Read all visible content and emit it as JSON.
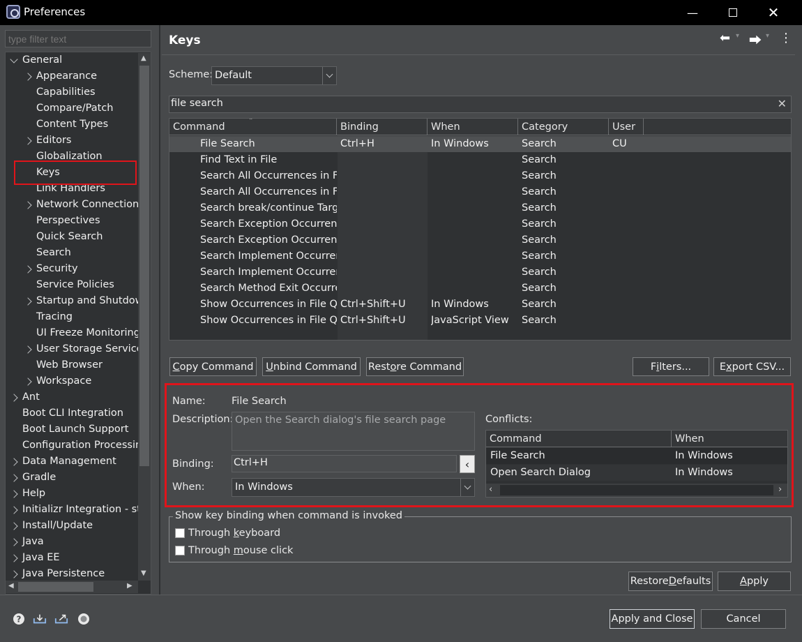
{
  "window": {
    "title": "Preferences"
  },
  "filter": {
    "placeholder": "type filter text"
  },
  "tree": [
    {
      "label": "General",
      "expander": "down",
      "indent": 0
    },
    {
      "label": "Appearance",
      "expander": "right",
      "indent": 1
    },
    {
      "label": "Capabilities",
      "expander": "",
      "indent": 1
    },
    {
      "label": "Compare/Patch",
      "expander": "",
      "indent": 1
    },
    {
      "label": "Content Types",
      "expander": "",
      "indent": 1
    },
    {
      "label": "Editors",
      "expander": "right",
      "indent": 1
    },
    {
      "label": "Globalization",
      "expander": "",
      "indent": 1
    },
    {
      "label": "Keys",
      "expander": "",
      "indent": 1
    },
    {
      "label": "Link Handlers",
      "expander": "",
      "indent": 1
    },
    {
      "label": "Network Connections",
      "expander": "right",
      "indent": 1
    },
    {
      "label": "Perspectives",
      "expander": "",
      "indent": 1
    },
    {
      "label": "Quick Search",
      "expander": "",
      "indent": 1
    },
    {
      "label": "Search",
      "expander": "",
      "indent": 1
    },
    {
      "label": "Security",
      "expander": "right",
      "indent": 1
    },
    {
      "label": "Service Policies",
      "expander": "",
      "indent": 1
    },
    {
      "label": "Startup and Shutdow",
      "expander": "right",
      "indent": 1
    },
    {
      "label": "Tracing",
      "expander": "",
      "indent": 1
    },
    {
      "label": "UI Freeze Monitoring",
      "expander": "",
      "indent": 1
    },
    {
      "label": "User Storage Service",
      "expander": "right",
      "indent": 1
    },
    {
      "label": "Web Browser",
      "expander": "",
      "indent": 1
    },
    {
      "label": "Workspace",
      "expander": "right",
      "indent": 1
    },
    {
      "label": "Ant",
      "expander": "right",
      "indent": 0
    },
    {
      "label": "Boot CLI Integration",
      "expander": "",
      "indent": 0
    },
    {
      "label": "Boot Launch Support",
      "expander": "",
      "indent": 0
    },
    {
      "label": "Configuration Processin",
      "expander": "",
      "indent": 0
    },
    {
      "label": "Data Management",
      "expander": "right",
      "indent": 0
    },
    {
      "label": "Gradle",
      "expander": "right",
      "indent": 0
    },
    {
      "label": "Help",
      "expander": "right",
      "indent": 0
    },
    {
      "label": "Initializr Integration - sta",
      "expander": "right",
      "indent": 0
    },
    {
      "label": "Install/Update",
      "expander": "right",
      "indent": 0
    },
    {
      "label": "Java",
      "expander": "right",
      "indent": 0
    },
    {
      "label": "Java EE",
      "expander": "right",
      "indent": 0
    },
    {
      "label": "Java Persistence",
      "expander": "right",
      "indent": 0
    }
  ],
  "page": {
    "title": "Keys",
    "scheme_label": "Scheme:",
    "scheme_value": "Default",
    "search_value": "file search"
  },
  "table": {
    "columns": [
      "Command",
      "Binding",
      "When",
      "Category",
      "User"
    ],
    "rows": [
      [
        "File Search",
        "Ctrl+H",
        "In Windows",
        "Search",
        "CU"
      ],
      [
        "Find Text in File",
        "",
        "",
        "Search",
        ""
      ],
      [
        "Search All Occurrences in File",
        "",
        "",
        "Search",
        ""
      ],
      [
        "Search All Occurrences in File",
        "",
        "",
        "Search",
        ""
      ],
      [
        "Search break/continue Target",
        "",
        "",
        "Search",
        ""
      ],
      [
        "Search Exception Occurrences",
        "",
        "",
        "Search",
        ""
      ],
      [
        "Search Exception Occurrences",
        "",
        "",
        "Search",
        ""
      ],
      [
        "Search Implement Occurrences",
        "",
        "",
        "Search",
        ""
      ],
      [
        "Search Implement Occurrences",
        "",
        "",
        "Search",
        ""
      ],
      [
        "Search Method Exit Occurrences",
        "",
        "",
        "Search",
        ""
      ],
      [
        "Show Occurrences in File Quick Menu",
        "Ctrl+Shift+U",
        "In Windows",
        "Search",
        ""
      ],
      [
        "Show Occurrences in File Quick Menu",
        "Ctrl+Shift+U",
        "JavaScript View",
        "Search",
        ""
      ]
    ]
  },
  "buttons": {
    "copy_command": {
      "pre": "",
      "key": "C",
      "post": "opy Command"
    },
    "unbind_command": {
      "pre": "",
      "key": "U",
      "post": "nbind Command"
    },
    "restore_command": {
      "pre": "Rest",
      "key": "o",
      "post": "re Command"
    },
    "filters": {
      "pre": "F",
      "key": "i",
      "post": "lters..."
    },
    "export_csv": {
      "pre": "E",
      "key": "x",
      "post": "port CSV..."
    },
    "restore_defaults": {
      "pre": "Restore ",
      "key": "D",
      "post": "efaults"
    },
    "apply": {
      "pre": "",
      "key": "A",
      "post": "pply"
    },
    "apply_and_close": "Apply and Close",
    "cancel": "Cancel"
  },
  "details": {
    "name_label": "Name:",
    "name_value": "File Search",
    "description_label": "Description:",
    "description_value": "Open the Search dialog's file search page",
    "binding_label": "Binding:",
    "binding_value": "Ctrl+H",
    "when_label": "When:",
    "when_value": "In Windows",
    "conflicts_label": "Conflicts:",
    "conflicts_columns": [
      "Command",
      "When"
    ],
    "conflicts_rows": [
      [
        "File Search",
        "In Windows"
      ],
      [
        "Open Search Dialog",
        "In Windows"
      ]
    ]
  },
  "show_binding": {
    "group_label": "Show key binding when command is invoked",
    "through_keyboard": {
      "pre": "Through ",
      "key": "k",
      "post": "eyboard"
    },
    "through_mouse": {
      "pre": "Through ",
      "key": "m",
      "post": "ouse click"
    }
  },
  "footer_icons": [
    "help-icon",
    "import-icon",
    "export-icon",
    "record-icon"
  ]
}
